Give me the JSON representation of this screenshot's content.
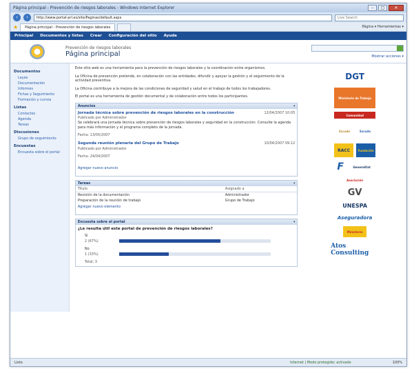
{
  "window": {
    "title": "Página principal - Prevención de riesgos laborales - Windows Internet Explorer",
    "url": "http://www.portal-prl.es/site/Paginas/default.aspx",
    "search_placeholder": "Live Search",
    "tab_label": "Página principal - Prevención de riesgos laborales",
    "toolbar_right": "Página ▾  Herramientas ▾"
  },
  "app_nav": [
    "Principal",
    "Documentos y listas",
    "Crear",
    "Configuración del sitio",
    "Ayuda"
  ],
  "header": {
    "subsite": "Prevención de riesgos laborales",
    "title": "Página principal",
    "search_placeholder": "",
    "site_link": "Mostrar acciones ▾"
  },
  "left_nav": [
    {
      "section": "Documentos",
      "items": [
        "Leyes",
        "Documentación",
        "Informes",
        "Fichas y Seguimiento",
        "Formación y cursos"
      ]
    },
    {
      "section": "Listas",
      "items": [
        "Contactos",
        "Agenda",
        "Tareas"
      ]
    },
    {
      "section": "Discusiones",
      "items": [
        "Grupo de seguimiento"
      ]
    },
    {
      "section": "Encuestas",
      "items": [
        "Encuesta sobre el portal"
      ]
    }
  ],
  "intro": [
    "Este sitio web es una herramienta para la prevención de riesgos laborales y la coordinación entre organismos.",
    "La Oficina de prevención pretende, en colaboración con las entidades, difundir y apoyar la gestión y el seguimiento de la actividad preventiva.",
    "La Oficina contribuye a la mejora de las condiciones de seguridad y salud en el trabajo de todos los trabajadores.",
    "El portal es una herramienta de gestión documental y de colaboración entre todos los participantes."
  ],
  "announcements": {
    "header": "Anuncios",
    "items": [
      {
        "title": "Jornada técnica sobre prevención de riesgos laborales en la construcción",
        "date": "12/04/2007 10:05",
        "meta": "Publicado por Administrador",
        "body": "Se celebrará una jornada técnica sobre prevención de riesgos laborales y seguridad en la construcción. Consulte la agenda para más información y el programa completo de la jornada.",
        "fecha": "Fecha: 13/05/2007"
      },
      {
        "title": "Segunda reunión plenaria del Grupo de Trabajo",
        "date": "10/04/2007 09:12",
        "meta": "Publicado por Administrador",
        "body": "",
        "fecha": "Fecha: 24/04/2007"
      }
    ],
    "add_link": "Agregar nuevo anuncio"
  },
  "tasks": {
    "header": "Tareas",
    "columns": [
      "Título",
      "Asignado a"
    ],
    "rows": [
      [
        "Revisión de la documentación",
        "Administrador"
      ],
      [
        "Preparación de la reunión de trabajo",
        "Grupo de Trabajo"
      ]
    ],
    "add_link": "Agregar nuevo elemento"
  },
  "survey": {
    "header": "Encuesta sobre el portal",
    "question": "¿Le resulta útil este portal de prevención de riesgos laborales?",
    "options": [
      {
        "label": "Sí",
        "pct_label": "2 (67%)",
        "fraction": 0.67
      },
      {
        "label": "No",
        "pct_label": "1 (33%)",
        "fraction": 0.33
      }
    ],
    "total": "Total: 3"
  },
  "status": {
    "left": "Listo",
    "zone": "Internet | Modo protegido: activado",
    "zoom": "100%"
  },
  "sponsors": [
    "DGT",
    "Ministerio de Trabajo",
    "Comunidad",
    "Escudo",
    "Escudo",
    "RACC",
    "Fundación",
    "F",
    "Generalitat",
    "Asociación",
    "GV",
    "UNESPA",
    "Aseguradora",
    "Ministerio",
    "Atos Consulting"
  ],
  "colors": {
    "nav_bar": "#1d4f95",
    "link": "#1c4f9e",
    "bar_fill": "#234d9a"
  }
}
